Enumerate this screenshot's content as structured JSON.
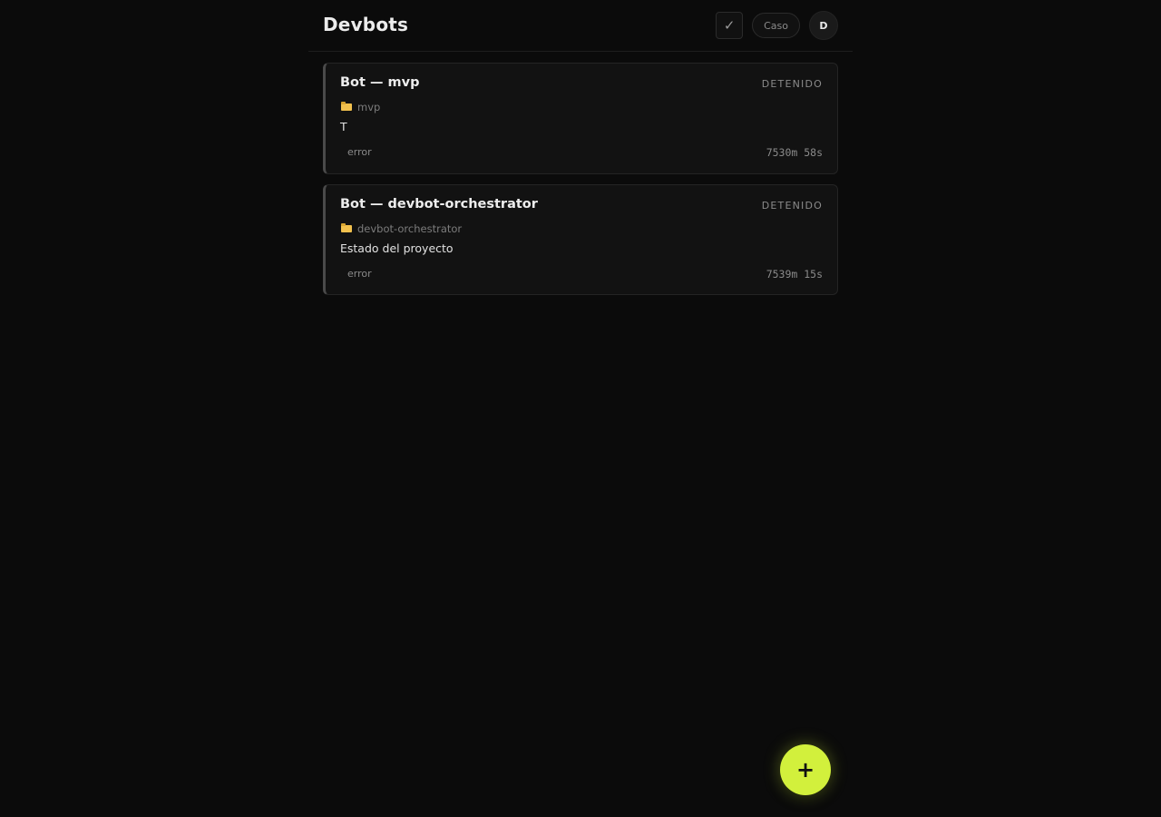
{
  "app": {
    "title": "Devbots"
  },
  "header": {
    "check_icon": "check-icon",
    "check_glyph": "✓",
    "caso_label": "Caso",
    "avatar_initial": "D"
  },
  "bots": [
    {
      "name": "Bot — mvp",
      "status": "DETENIDO",
      "folder_icon": "folder-icon",
      "folder": "mvp",
      "description": "T",
      "tag": "error",
      "elapsed": "7530m 58s"
    },
    {
      "name": "Bot — devbot-orchestrator",
      "status": "DETENIDO",
      "folder_icon": "folder-icon",
      "folder": "devbot-orchestrator",
      "description": "Estado del proyecto",
      "tag": "error",
      "elapsed": "7539m 15s"
    }
  ],
  "fab": {
    "icon": "plus-icon",
    "glyph": "+"
  },
  "colors": {
    "background": "#0b0b0b",
    "card": "#121212",
    "accent": "#d2f03c",
    "folder": "#f2c14e"
  }
}
